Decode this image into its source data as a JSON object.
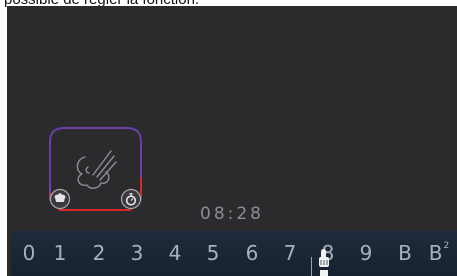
{
  "caption": "possible de régler la fonction.",
  "timer": "08:28",
  "scale": {
    "labels": [
      "0",
      "1",
      "2",
      "3",
      "4",
      "5",
      "6",
      "7",
      "8",
      "9",
      "B",
      "B"
    ],
    "last_superscript": "2"
  },
  "tile": {
    "icon": "steam-icon",
    "left_badge_icon": "chef-hat-icon",
    "right_badge_icon": "timer-icon"
  },
  "colors": {
    "screen_bg": "#2b2b2e",
    "tile_frame": "#6a3fa8",
    "tile_active_edge": "#d4282b",
    "scale_bar": "#1e2b3c",
    "scale_text": "#a9b0ba"
  }
}
